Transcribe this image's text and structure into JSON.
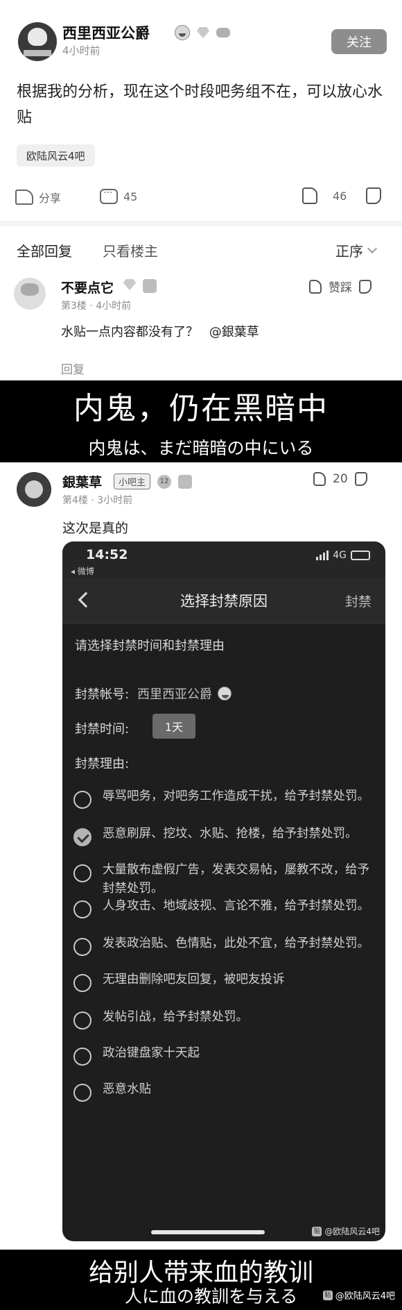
{
  "post": {
    "username": "西里西亚公爵",
    "timestamp": "4小时前",
    "follow_label": "关注",
    "body": "根据我的分析，现在这个时段吧务组不在，可以放心水贴",
    "forum_tag": "欧陆风云4吧",
    "share_label": "分享",
    "comment_count": "45",
    "like_count": "46"
  },
  "sort_bar": {
    "all_replies": "全部回复",
    "op_only": "只看楼主",
    "order": "正序"
  },
  "comment1": {
    "name": "不要点它",
    "meta": "第3楼 · 4小时前",
    "text": "水贴一点内容都没有了？",
    "mention": "@銀葉草",
    "like_label": "赞踩",
    "reply_label": "回复"
  },
  "subtitle1": {
    "zh": "内鬼，仍在黑暗中",
    "ja": "内鬼は、まだ暗暗の中にいる"
  },
  "comment2": {
    "name": "銀葉草",
    "badge": "小吧主",
    "level_badge": "12",
    "meta": "第4楼 · 3小时前",
    "like_count": "20",
    "text": "这次是真的"
  },
  "phone": {
    "time": "14:52",
    "back_app": "◂ 微博",
    "network": "4G",
    "title": "选择封禁原因",
    "action": "封禁",
    "prompt": "请选择封禁时间和封禁理由",
    "account_label": "封禁帐号:",
    "account_value": "西里西亚公爵",
    "duration_label": "封禁时间:",
    "duration_value": "1天",
    "reason_label": "封禁理由:",
    "reasons": [
      {
        "text": "辱骂吧务，对吧务工作造成干扰，给予封禁处罚。",
        "checked": false
      },
      {
        "text": "恶意刷屏、挖坟、水贴、抢楼，给予封禁处罚。",
        "checked": true
      },
      {
        "text": "大量散布虚假广告，发表交易帖，屡教不改，给予封禁处罚。",
        "checked": false
      },
      {
        "text": "人身攻击、地域歧视、言论不雅，给予封禁处罚。",
        "checked": false
      },
      {
        "text": "发表政治贴、色情贴，此处不宜，给予封禁处罚。",
        "checked": false
      },
      {
        "text": "无理由删除吧友回复，被吧友投诉",
        "checked": false
      },
      {
        "text": "发帖引战，给予封禁处罚。",
        "checked": false
      },
      {
        "text": "政治键盘家十天起",
        "checked": false
      },
      {
        "text": "恶意水贴",
        "checked": false
      }
    ],
    "watermark": "@欧陆风云4吧"
  },
  "subtitle2": {
    "zh": "给别人带来血的教训",
    "ja": "人に血の教訓を与える",
    "watermark": "@欧陆风云4吧"
  },
  "colors": {
    "band": "#000000",
    "phone_bg": "#1e1e1e",
    "follow_btn": "#8d8d8d"
  }
}
